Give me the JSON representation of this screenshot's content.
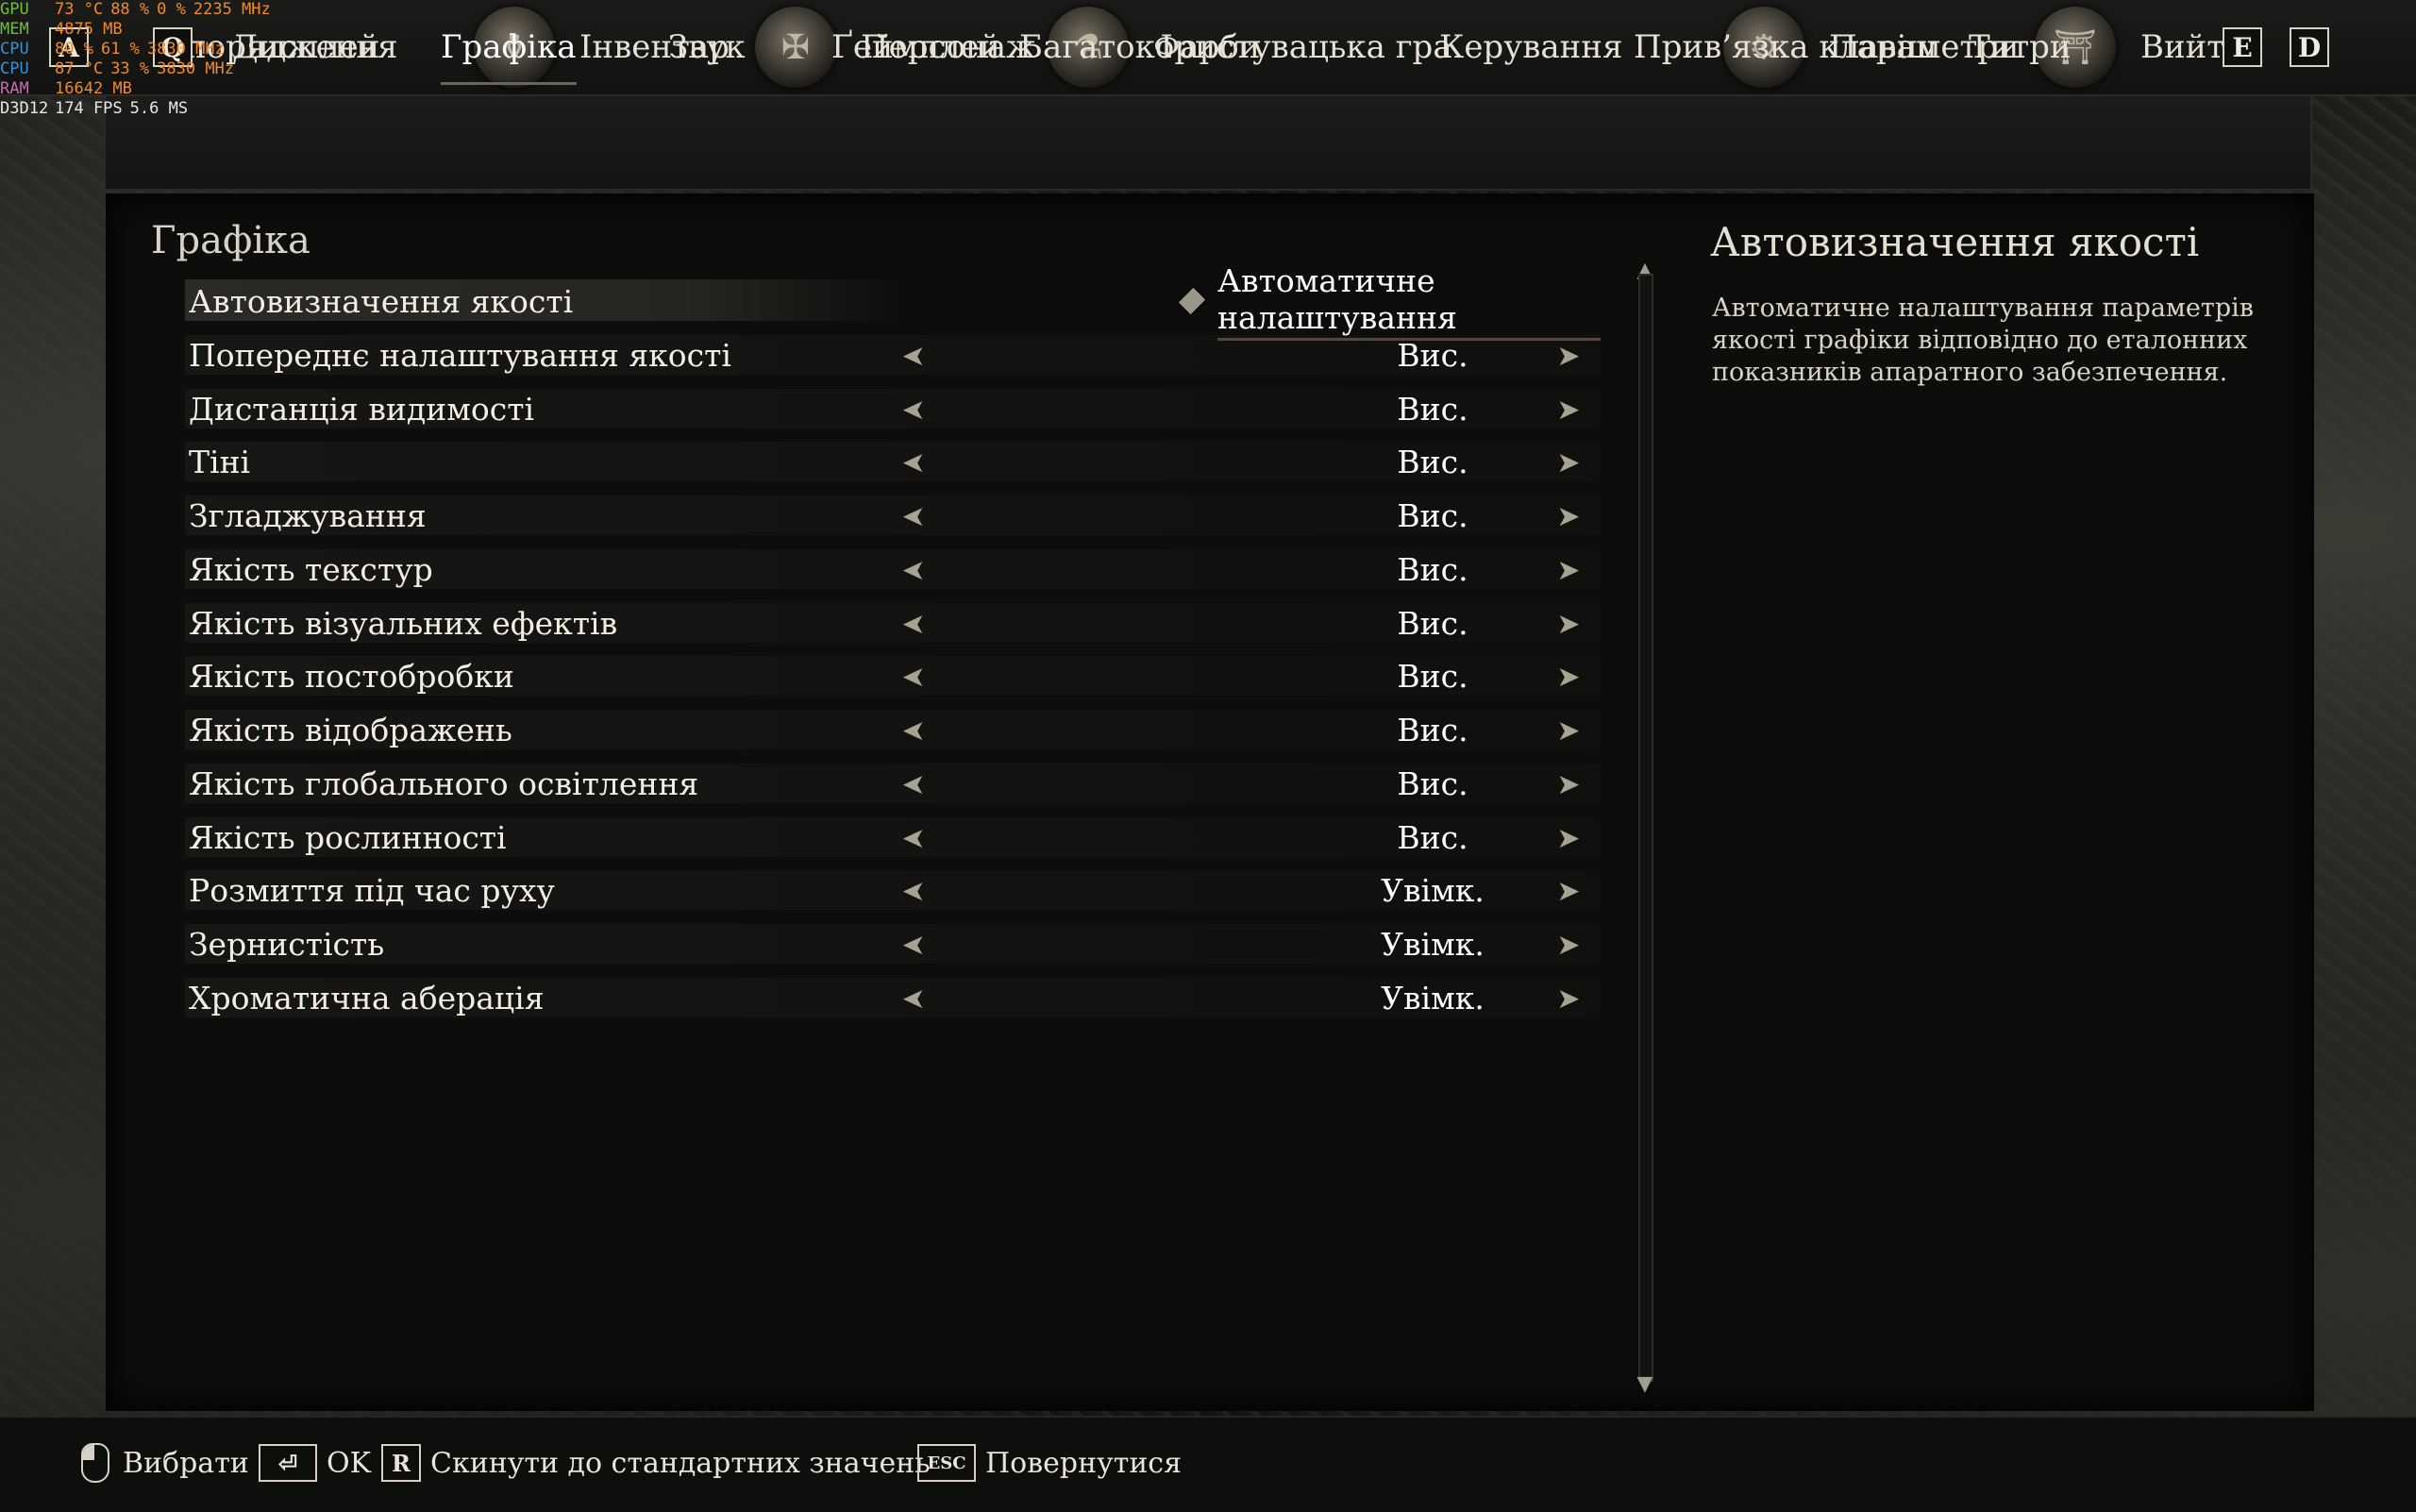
{
  "perf_overlay": [
    {
      "label": "GPU",
      "label_color": "g",
      "values": [
        "73 °C",
        "88 %",
        "0 %",
        "2235 MHz"
      ]
    },
    {
      "label": "MEM",
      "label_color": "g",
      "values": [
        "4875 MB"
      ]
    },
    {
      "label": "CPU",
      "label_color": "b",
      "values": [
        "80 %",
        "61 %",
        "3830 MHz"
      ]
    },
    {
      "label": "CPU",
      "label_color": "b",
      "values": [
        "87 °C",
        "33 %",
        "3830 MHz"
      ]
    },
    {
      "label": "RAM",
      "label_color": "p",
      "values": [
        "16642 MB"
      ]
    },
    {
      "label": "D3D12",
      "label_color": "w",
      "values": [
        "174 FPS",
        "5.6 MS"
      ]
    }
  ],
  "topnav": {
    "left_key": "A",
    "right_key": "D",
    "items": [
      {
        "label": "Спорядження",
        "icon": "equipment-icon"
      },
      {
        "label": "Інвентар",
        "icon": "inventory-icon"
      },
      {
        "label": "Персонаж",
        "icon": "character-icon"
      },
      {
        "label": "Фарби",
        "icon": "paints-icon"
      },
      {
        "label": "Параметри",
        "icon": "settings-gear-icon"
      },
      {
        "label": "Вийти",
        "icon": "exit-gate-icon"
      }
    ]
  },
  "tabs": {
    "left_key": "Q",
    "right_key": "E",
    "active": "Графіка",
    "items": [
      "Дисплей",
      "Графіка",
      "Звук",
      "Ґеймплей",
      "Багатокористувацька гра",
      "Керування",
      "Прив’язка клавіш",
      "Титри"
    ]
  },
  "section_title": "Графіка",
  "settings": [
    {
      "name": "Автовизначення якості",
      "value": "Автоматичне налаштування",
      "type": "toggle-button"
    },
    {
      "name": "Попереднє налаштування якості",
      "value": "Вис."
    },
    {
      "name": "Дистанція видимості",
      "value": "Вис."
    },
    {
      "name": "Тіні",
      "value": "Вис."
    },
    {
      "name": "Згладжування",
      "value": "Вис."
    },
    {
      "name": "Якість текстур",
      "value": "Вис."
    },
    {
      "name": "Якість візуальних ефектів",
      "value": "Вис."
    },
    {
      "name": "Якість постобробки",
      "value": "Вис."
    },
    {
      "name": "Якість відображень",
      "value": "Вис."
    },
    {
      "name": "Якість глобального освітлення",
      "value": "Вис."
    },
    {
      "name": "Якість рослинності",
      "value": "Вис."
    },
    {
      "name": "Розмиття під час руху",
      "value": "Увімк."
    },
    {
      "name": "Зернистість",
      "value": "Увімк."
    },
    {
      "name": "Хроматична аберація",
      "value": "Увімк."
    }
  ],
  "description": {
    "title": "Автовизначення якості",
    "text": "Автоматичне налаштування параметрів якості графіки відповідно до еталонних показників апаратного забезпечення."
  },
  "footer": {
    "select": "Вибрати",
    "ok": "OK",
    "reset_key": "R",
    "reset": "Скинути до стандартних значень",
    "back_key": "ESC",
    "back": "Повернутися"
  }
}
